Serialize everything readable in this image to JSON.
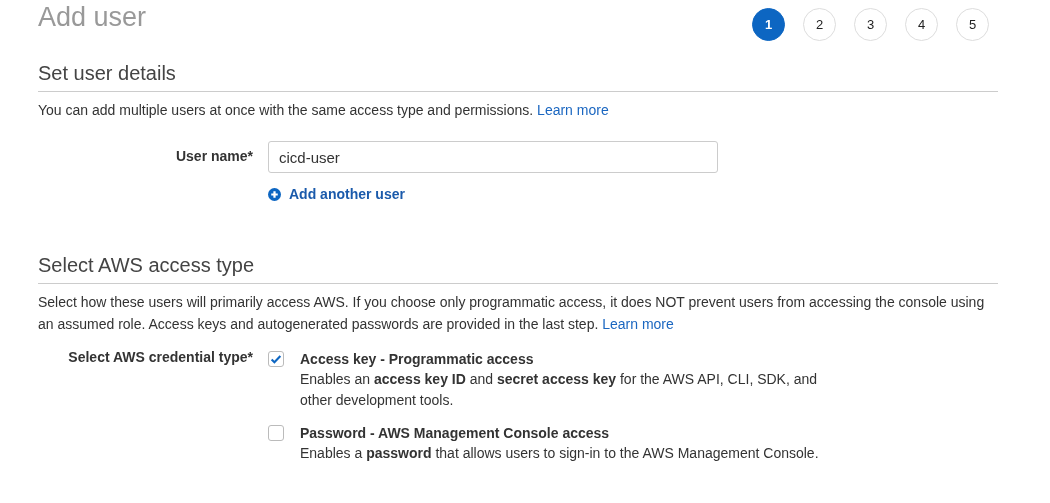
{
  "page_title": "Add user",
  "steps": [
    {
      "label": "1",
      "selected": true
    },
    {
      "label": "2",
      "selected": false
    },
    {
      "label": "3",
      "selected": false
    },
    {
      "label": "4",
      "selected": false
    },
    {
      "label": "5",
      "selected": false
    }
  ],
  "sections": [
    {
      "heading": "Set user details",
      "description": "You can add multiple users at once with the same access type and permissions.",
      "link": "Learn more",
      "kind": "user_name",
      "field": {
        "label": "User name*",
        "value": "cicd-user"
      },
      "add_link": "Add another user"
    },
    {
      "heading": "Select AWS access type",
      "description": "Select how these users will primarily access AWS. If you choose only programmatic access, it does NOT prevent users from accessing the console using an assumed role. Access keys and autogenerated passwords are provided in the last step.",
      "link": "Learn more",
      "kind": "access_type",
      "field": {
        "label": "Select AWS credential type*"
      },
      "options": [
        {
          "title": "Access key - Programmatic access",
          "description": "Enables an **access key ID** and **secret access key** for the AWS API, CLI, SDK, and other development tools.",
          "checked": true
        },
        {
          "title": "Password - AWS Management Console access",
          "description": "Enables a **password** that allows users to sign-in to the AWS Management Console.",
          "checked": false
        }
      ]
    }
  ]
}
